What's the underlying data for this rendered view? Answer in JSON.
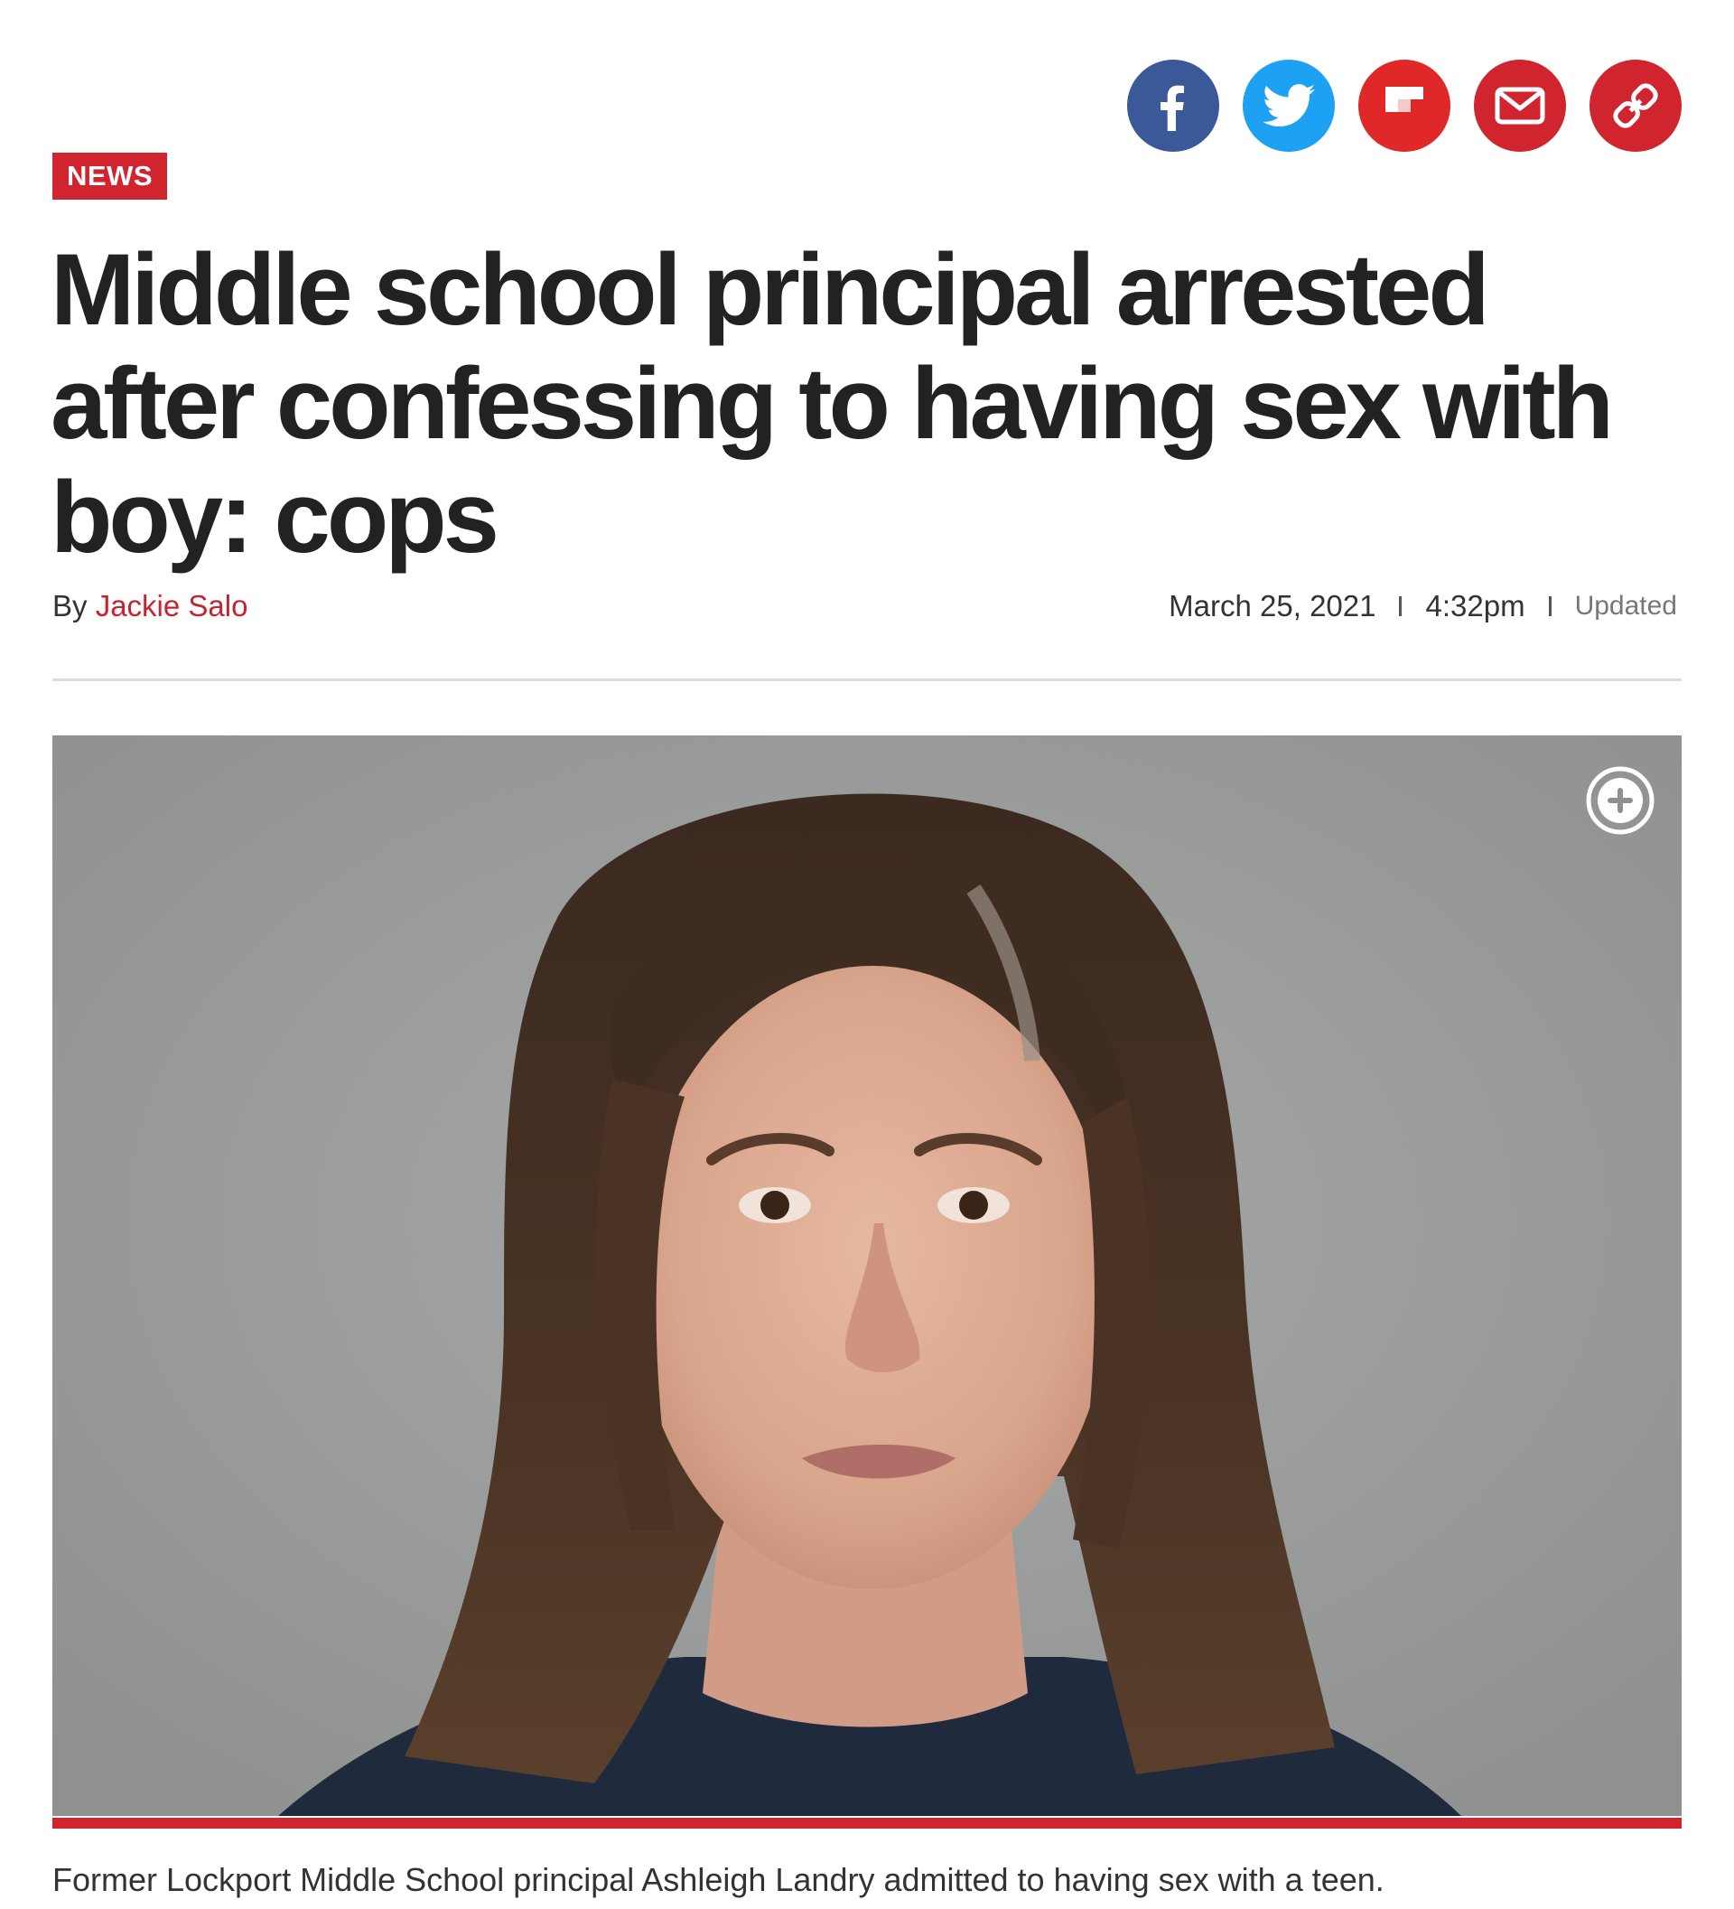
{
  "share": {
    "buttons": [
      {
        "name": "facebook",
        "icon": "facebook-icon",
        "color": "#3b5998"
      },
      {
        "name": "twitter",
        "icon": "twitter-icon",
        "color": "#1da1f2"
      },
      {
        "name": "flipboard",
        "icon": "flipboard-icon",
        "color": "#e12828"
      },
      {
        "name": "email",
        "icon": "email-icon",
        "color": "#d0242f"
      },
      {
        "name": "copy-link",
        "icon": "link-icon",
        "color": "#d0242f"
      }
    ]
  },
  "article": {
    "category": "NEWS",
    "headline": "Middle school principal arrested after confessing to having sex with boy: cops",
    "byline_prefix": "By",
    "author": "Jackie Salo",
    "date": "March 25, 2021",
    "time": "4:32pm",
    "updated_label": "Updated",
    "photo": {
      "expand_icon": "expand-plus-icon",
      "caption": "Former Lockport Middle School principal Ashleigh Landry admitted to having sex with a teen."
    }
  },
  "colors": {
    "accent": "#d0242f",
    "author_link": "#c8232c",
    "headline": "#222222"
  }
}
